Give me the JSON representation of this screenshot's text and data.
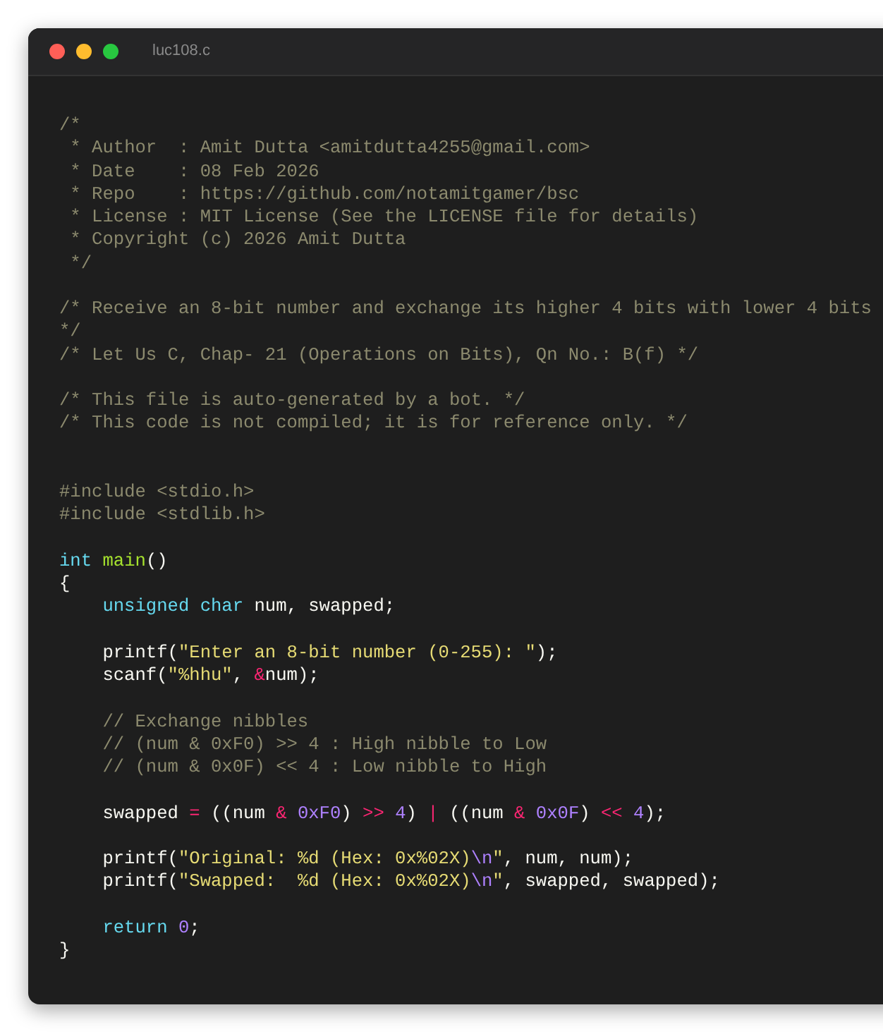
{
  "window": {
    "title": "luc108.c",
    "controls": [
      {
        "kind": "close"
      },
      {
        "kind": "minimize"
      },
      {
        "kind": "maximize"
      }
    ]
  },
  "code": [
    {
      "kind": "code",
      "indented": false,
      "tokens": [
        {
          "kind": "comment",
          "text": "/*"
        }
      ]
    },
    {
      "kind": "code",
      "indented": false,
      "tokens": [
        {
          "kind": "comment",
          "text": " * Author  : Amit Dutta <amitdutta4255@gmail.com>"
        }
      ]
    },
    {
      "kind": "code",
      "indented": false,
      "tokens": [
        {
          "kind": "comment",
          "text": " * Date    : 08 Feb 2026"
        }
      ]
    },
    {
      "kind": "code",
      "indented": false,
      "tokens": [
        {
          "kind": "comment",
          "text": " * Repo    : https://github.com/notamitgamer/bsc"
        }
      ]
    },
    {
      "kind": "code",
      "indented": false,
      "tokens": [
        {
          "kind": "comment",
          "text": " * License : MIT License (See the LICENSE file for details)"
        }
      ]
    },
    {
      "kind": "code",
      "indented": false,
      "tokens": [
        {
          "kind": "comment",
          "text": " * Copyright (c) 2026 Amit Dutta"
        }
      ]
    },
    {
      "kind": "code",
      "indented": false,
      "tokens": [
        {
          "kind": "comment",
          "text": " */"
        }
      ]
    },
    {
      "kind": "blank"
    },
    {
      "kind": "code",
      "indented": false,
      "tokens": [
        {
          "kind": "comment",
          "text": "/* Receive an 8-bit number and exchange its higher 4 bits with lower 4 bits"
        }
      ]
    },
    {
      "kind": "code",
      "indented": false,
      "tokens": [
        {
          "kind": "comment",
          "text": "*/"
        }
      ]
    },
    {
      "kind": "code",
      "indented": false,
      "tokens": [
        {
          "kind": "comment",
          "text": "/* Let Us C, Chap- 21 (Operations on Bits), Qn No.: B(f) */"
        }
      ]
    },
    {
      "kind": "blank"
    },
    {
      "kind": "code",
      "indented": false,
      "tokens": [
        {
          "kind": "comment",
          "text": "/* This file is auto-generated by a bot. */"
        }
      ]
    },
    {
      "kind": "code",
      "indented": false,
      "tokens": [
        {
          "kind": "comment",
          "text": "/* This code is not compiled; it is for reference only. */"
        }
      ]
    },
    {
      "kind": "blank"
    },
    {
      "kind": "blank"
    },
    {
      "kind": "code",
      "indented": false,
      "tokens": [
        {
          "kind": "preproc",
          "text": "#include <stdio.h>"
        }
      ]
    },
    {
      "kind": "code",
      "indented": false,
      "tokens": [
        {
          "kind": "preproc",
          "text": "#include <stdlib.h>"
        }
      ]
    },
    {
      "kind": "blank"
    },
    {
      "kind": "code",
      "indented": false,
      "tokens": [
        {
          "kind": "keyword",
          "text": "int "
        },
        {
          "kind": "function",
          "text": "main"
        },
        {
          "kind": "plain",
          "text": "()"
        }
      ]
    },
    {
      "kind": "code",
      "indented": false,
      "tokens": [
        {
          "kind": "plain",
          "text": "{"
        }
      ]
    },
    {
      "kind": "code",
      "indented": true,
      "tokens": [
        {
          "kind": "keyword",
          "text": "unsigned char"
        },
        {
          "kind": "plain",
          "text": " num, swapped;"
        }
      ]
    },
    {
      "kind": "blank"
    },
    {
      "kind": "code",
      "indented": true,
      "tokens": [
        {
          "kind": "plain",
          "text": "printf("
        },
        {
          "kind": "string",
          "text": "\"Enter an 8-bit number (0-255): \""
        },
        {
          "kind": "plain",
          "text": ");"
        }
      ]
    },
    {
      "kind": "code",
      "indented": true,
      "tokens": [
        {
          "kind": "plain",
          "text": "scanf("
        },
        {
          "kind": "string",
          "text": "\"%hhu\""
        },
        {
          "kind": "plain",
          "text": ", "
        },
        {
          "kind": "operator",
          "text": "&"
        },
        {
          "kind": "plain",
          "text": "num);"
        }
      ]
    },
    {
      "kind": "blank"
    },
    {
      "kind": "code",
      "indented": true,
      "tokens": [
        {
          "kind": "comment",
          "text": "// Exchange nibbles"
        }
      ]
    },
    {
      "kind": "code",
      "indented": true,
      "tokens": [
        {
          "kind": "comment",
          "text": "// (num & 0xF0) >> 4 : High nibble to Low"
        }
      ]
    },
    {
      "kind": "code",
      "indented": true,
      "tokens": [
        {
          "kind": "comment",
          "text": "// (num & 0x0F) << 4 : Low nibble to High"
        }
      ]
    },
    {
      "kind": "blank"
    },
    {
      "kind": "code",
      "indented": true,
      "tokens": [
        {
          "kind": "plain",
          "text": "swapped "
        },
        {
          "kind": "operator",
          "text": "= "
        },
        {
          "kind": "plain",
          "text": "((num "
        },
        {
          "kind": "operator",
          "text": "& "
        },
        {
          "kind": "number",
          "text": "0xF0"
        },
        {
          "kind": "plain",
          "text": ") "
        },
        {
          "kind": "operator",
          "text": ">> "
        },
        {
          "kind": "number",
          "text": "4"
        },
        {
          "kind": "plain",
          "text": ") "
        },
        {
          "kind": "operator",
          "text": "| "
        },
        {
          "kind": "plain",
          "text": "((num "
        },
        {
          "kind": "operator",
          "text": "& "
        },
        {
          "kind": "number",
          "text": "0x0F"
        },
        {
          "kind": "plain",
          "text": ") "
        },
        {
          "kind": "operator",
          "text": "<< "
        },
        {
          "kind": "number",
          "text": "4"
        },
        {
          "kind": "plain",
          "text": ");"
        }
      ]
    },
    {
      "kind": "blank"
    },
    {
      "kind": "code",
      "indented": true,
      "tokens": [
        {
          "kind": "plain",
          "text": "printf("
        },
        {
          "kind": "string",
          "text": "\"Original: %d (Hex: 0x%02X)"
        },
        {
          "kind": "number",
          "text": "\\n"
        },
        {
          "kind": "string",
          "text": "\""
        },
        {
          "kind": "plain",
          "text": ", num, num);"
        }
      ]
    },
    {
      "kind": "code",
      "indented": true,
      "tokens": [
        {
          "kind": "plain",
          "text": "printf("
        },
        {
          "kind": "string",
          "text": "\"Swapped:  %d (Hex: 0x%02X)"
        },
        {
          "kind": "number",
          "text": "\\n"
        },
        {
          "kind": "string",
          "text": "\""
        },
        {
          "kind": "plain",
          "text": ", swapped, swapped);"
        }
      ]
    },
    {
      "kind": "blank"
    },
    {
      "kind": "code",
      "indented": true,
      "tokens": [
        {
          "kind": "keyword",
          "text": "return "
        },
        {
          "kind": "number",
          "text": "0"
        },
        {
          "kind": "plain",
          "text": ";"
        }
      ]
    },
    {
      "kind": "code",
      "indented": false,
      "tokens": [
        {
          "kind": "plain",
          "text": "}"
        }
      ]
    }
  ]
}
